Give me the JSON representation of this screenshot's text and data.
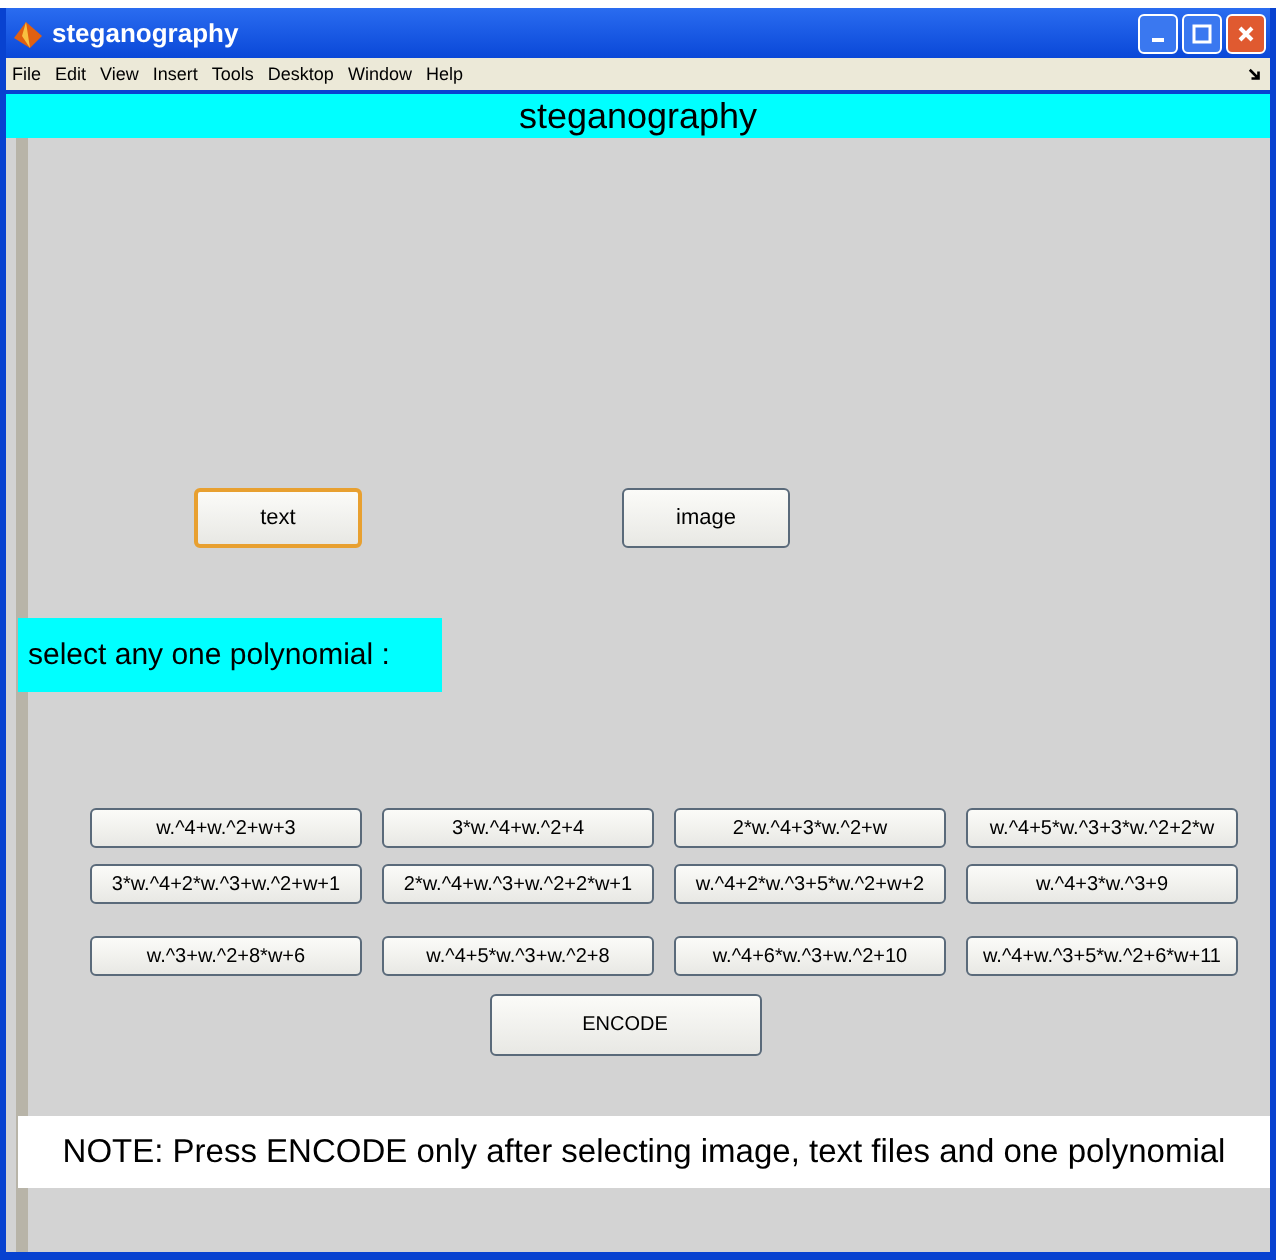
{
  "window": {
    "title": "steganography"
  },
  "menu": [
    "File",
    "Edit",
    "View",
    "Insert",
    "Tools",
    "Desktop",
    "Window",
    "Help"
  ],
  "header": "steganography",
  "file_buttons": [
    {
      "label": "text",
      "focused": true
    },
    {
      "label": "image",
      "focused": false
    }
  ],
  "prompt": "select any one polynomial :",
  "polynomials": [
    [
      {
        "label": "w.^4+w.^2+w+3"
      },
      {
        "label": "3*w.^4+w.^2+4"
      },
      {
        "label": "2*w.^4+3*w.^2+w"
      },
      {
        "label": "w.^4+5*w.^3+3*w.^2+2*w"
      }
    ],
    [
      {
        "label": "3*w.^4+2*w.^3+w.^2+w+1"
      },
      {
        "label": "2*w.^4+w.^3+w.^2+2*w+1"
      },
      {
        "label": "w.^4+2*w.^3+5*w.^2+w+2"
      },
      {
        "label": "w.^4+3*w.^3+9"
      }
    ],
    [
      {
        "label": "w.^3+w.^2+8*w+6"
      },
      {
        "label": "w.^4+5*w.^3+w.^2+8"
      },
      {
        "label": "w.^4+6*w.^3+w.^2+10"
      },
      {
        "label": "w.^4+w.^3+5*w.^2+6*w+11"
      }
    ]
  ],
  "encode_button": "ENCODE",
  "note": "NOTE: Press ENCODE only after selecting image, text files and one polynomial"
}
